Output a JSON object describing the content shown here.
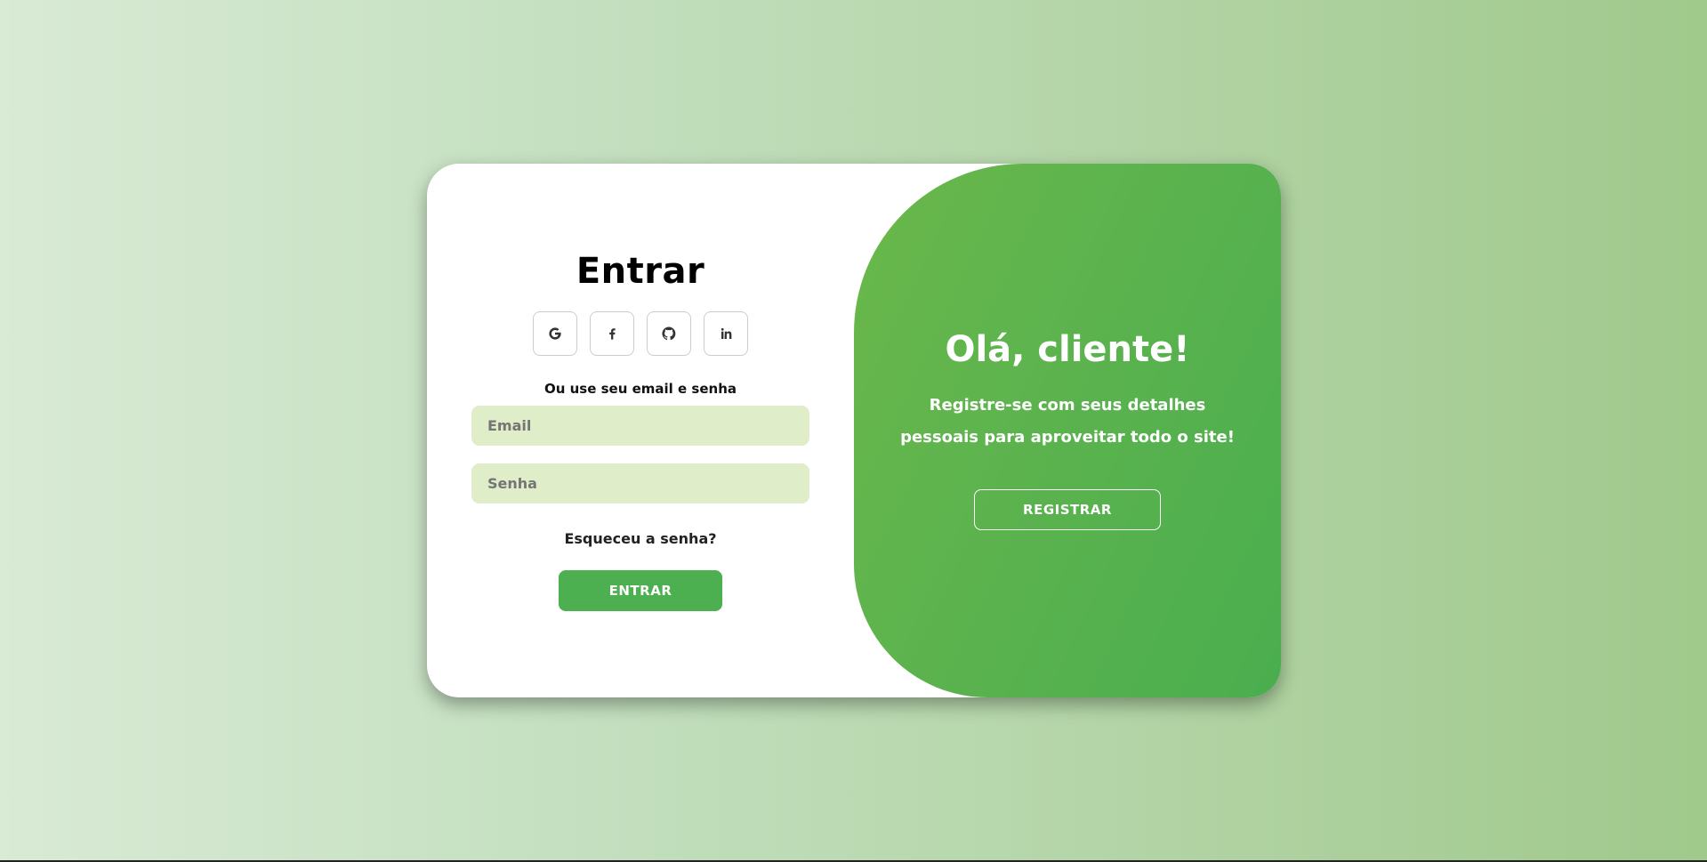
{
  "signin": {
    "title": "Entrar",
    "socials": [
      {
        "icon": "google-icon",
        "label": "G"
      },
      {
        "icon": "facebook-icon",
        "label": "f"
      },
      {
        "icon": "github-icon",
        "label": ""
      },
      {
        "icon": "linkedin-icon",
        "label": "in"
      }
    ],
    "subtitle": "Ou use seu email e senha",
    "email_placeholder": "Email",
    "password_placeholder": "Senha",
    "forgot_label": "Esqueceu a senha?",
    "submit_label": "ENTRAR"
  },
  "toggle": {
    "title": "Olá, cliente!",
    "text": "Registre-se com seus detalhes pessoais para aproveitar todo o site!",
    "register_label": "REGISTRAR"
  },
  "colors": {
    "accent": "#4caf50",
    "input_bg": "#dfedc9",
    "panel_gradient_start": "#6ab84a",
    "panel_gradient_end": "#4aae4e"
  }
}
